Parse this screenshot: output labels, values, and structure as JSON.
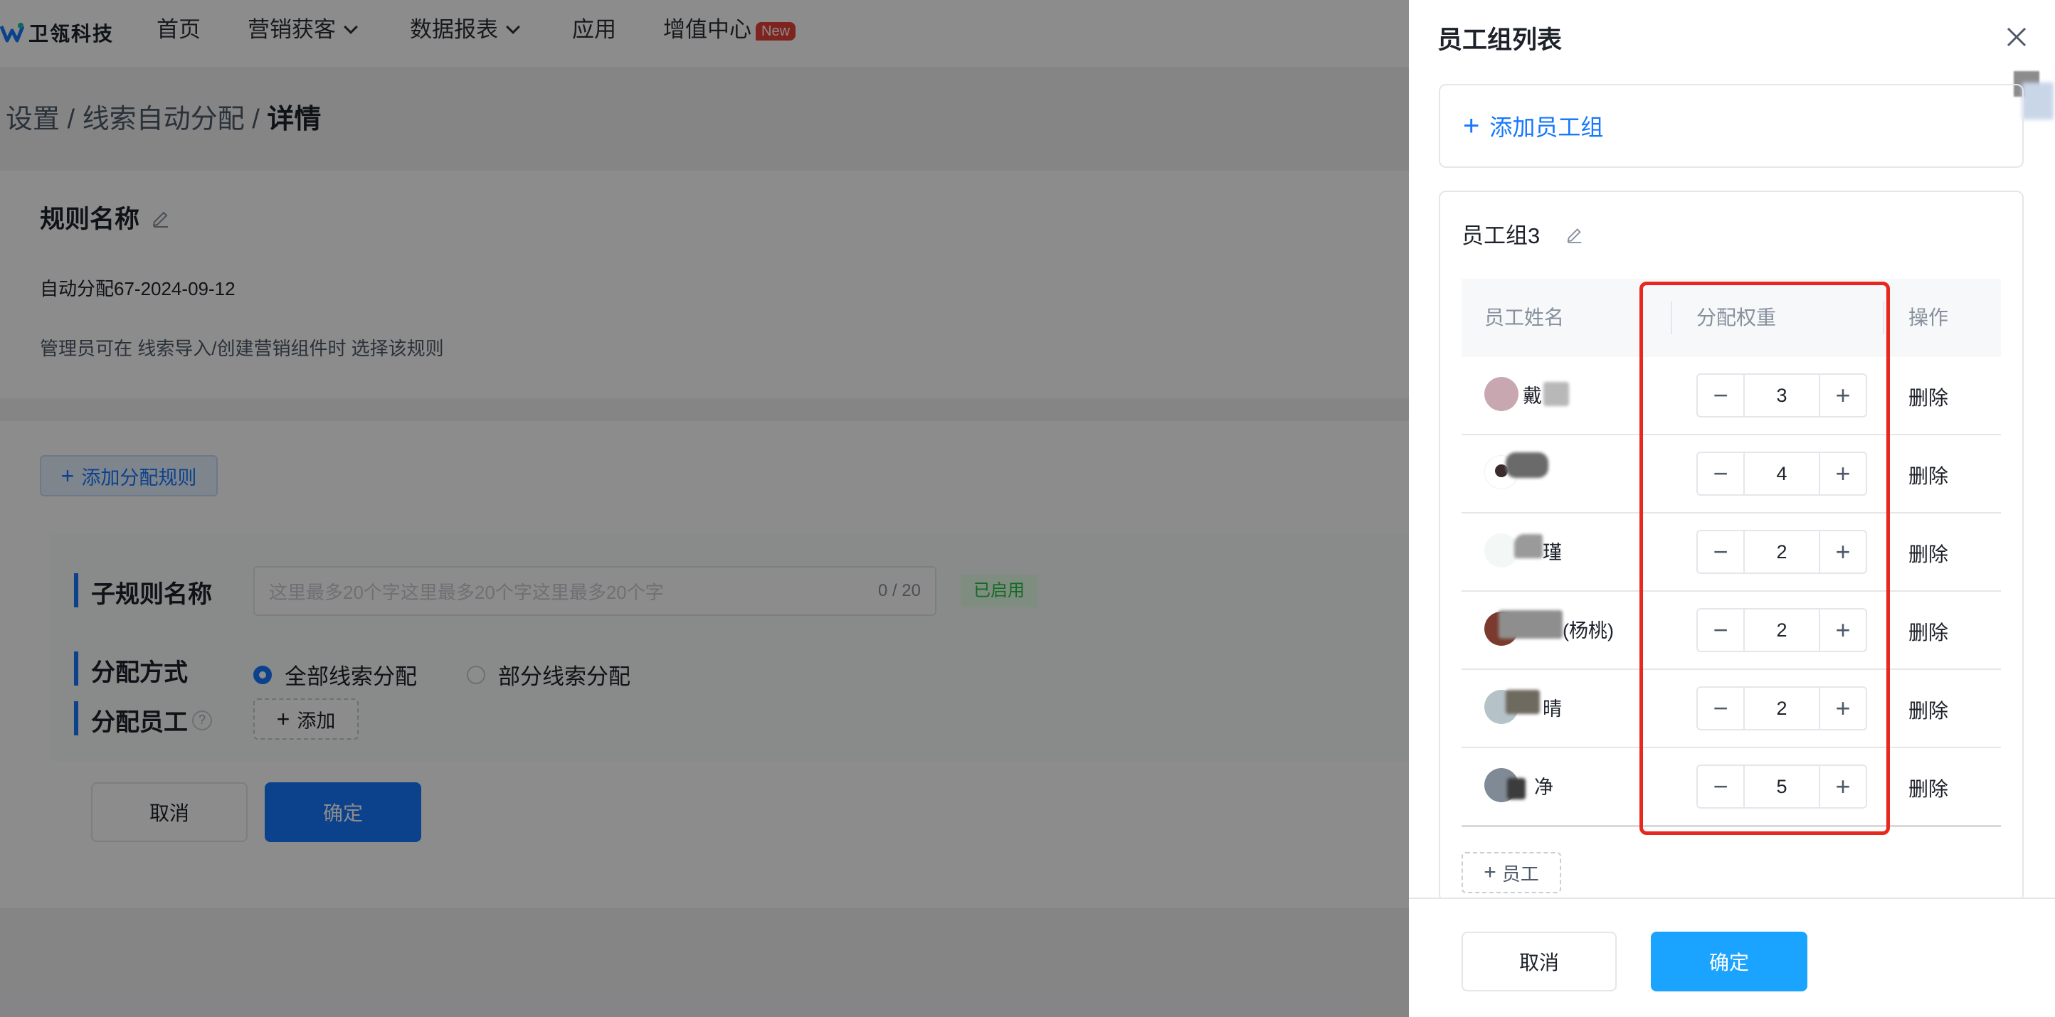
{
  "nav": {
    "logo_text": "卫瓴科技",
    "items": [
      "首页",
      "营销获客",
      "数据报表",
      "应用",
      "增值中心"
    ],
    "new_badge": "New"
  },
  "breadcrumb": {
    "part1": "设置 / 线索自动分配 / ",
    "current": "详情"
  },
  "rule": {
    "title": "规则名称",
    "name": "自动分配67-2024-09-12",
    "desc": "管理员可在 线索导入/创建营销组件时 选择该规则"
  },
  "add_rule_label": "添加分配规则",
  "subrule": {
    "name_label": "子规则名称",
    "name_placeholder": "这里最多20个字这里最多20个字这里最多20个字",
    "name_count": "0 / 20",
    "status": "已启用",
    "method_label": "分配方式",
    "method_all": "全部线索分配",
    "method_part": "部分线索分配",
    "staff_label": "分配员工",
    "help_icon": "?",
    "add_label": "添加",
    "cancel": "取消",
    "ok": "确定"
  },
  "drawer": {
    "title": "员工组列表",
    "add_group_label": "添加员工组",
    "group_name": "员工组3",
    "columns": [
      "员工姓名",
      "分配权重",
      "操作"
    ],
    "employees": [
      {
        "name": "戴",
        "weight": "3",
        "action": "删除"
      },
      {
        "name": "",
        "weight": "4",
        "action": "删除"
      },
      {
        "name": "瑾",
        "weight": "2",
        "action": "删除"
      },
      {
        "name": "(杨桃)",
        "weight": "2",
        "action": "删除"
      },
      {
        "name": "晴",
        "weight": "2",
        "action": "删除"
      },
      {
        "name": "净",
        "weight": "5",
        "action": "删除"
      }
    ],
    "add_employee_label": "员工",
    "cancel": "取消",
    "ok": "确定"
  },
  "colors": {
    "primary": "#1677ff",
    "drawer_primary": "#1aa3ff",
    "highlight": "#e8281e",
    "new_badge": "#e8403a"
  }
}
